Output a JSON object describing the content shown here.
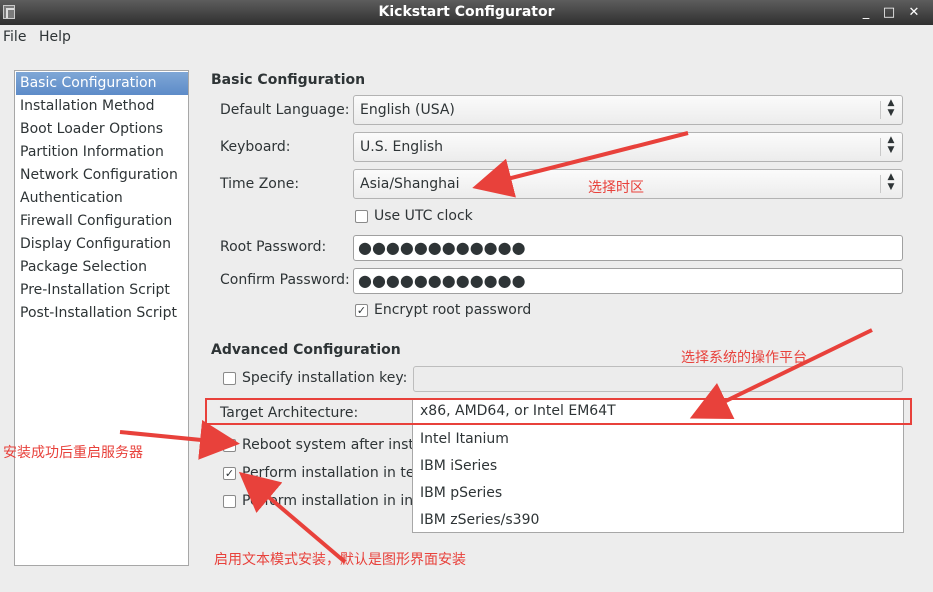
{
  "window": {
    "title": "Kickstart Configurator",
    "controls": {
      "minimize": "_",
      "maximize": "□",
      "close": "✕"
    }
  },
  "menubar": {
    "items": [
      "File",
      "Help"
    ]
  },
  "sidebar": {
    "selected_index": 0,
    "items": [
      "Basic Configuration",
      "Installation Method",
      "Boot Loader Options",
      "Partition Information",
      "Network Configuration",
      "Authentication",
      "Firewall Configuration",
      "Display Configuration",
      "Package Selection",
      "Pre-Installation Script",
      "Post-Installation Script"
    ]
  },
  "basic": {
    "title": "Basic Configuration",
    "default_language": {
      "label": "Default Language:",
      "value": "English (USA)"
    },
    "keyboard": {
      "label": "Keyboard:",
      "value": "U.S. English"
    },
    "time_zone": {
      "label": "Time Zone:",
      "value": "Asia/Shanghai"
    },
    "utc_clock": {
      "label": "Use UTC clock",
      "checked": false
    },
    "root_password": {
      "label": "Root Password:",
      "value": "●●●●●●●●●●●●"
    },
    "confirm_password": {
      "label": "Confirm Password:",
      "value": "●●●●●●●●●●●●"
    },
    "encrypt": {
      "label": "Encrypt root password",
      "checked": true
    }
  },
  "advanced": {
    "title": "Advanced Configuration",
    "install_key": {
      "label": "Specify installation key:",
      "checked": false
    },
    "target_arch": {
      "label": "Target Architecture:",
      "options": [
        "x86, AMD64, or Intel EM64T",
        "Intel Itanium",
        "IBM iSeries",
        "IBM pSeries",
        "IBM zSeries/s390"
      ],
      "selected": "x86, AMD64, or Intel EM64T"
    },
    "reboot": {
      "label": "Reboot system after instal",
      "checked": true
    },
    "text_mode": {
      "label": "Perform installation in tex",
      "checked": true
    },
    "interactive": {
      "label": "Perform installation in inte",
      "checked": false
    }
  },
  "annotations": {
    "time_zone_note": "选择时区",
    "arch_note": "选择系统的操作平台",
    "reboot_note": "安装成功后重启服务器",
    "text_mode_note": "启用文本模式安装，默认是图形界面安装",
    "color": "#e8413b"
  }
}
